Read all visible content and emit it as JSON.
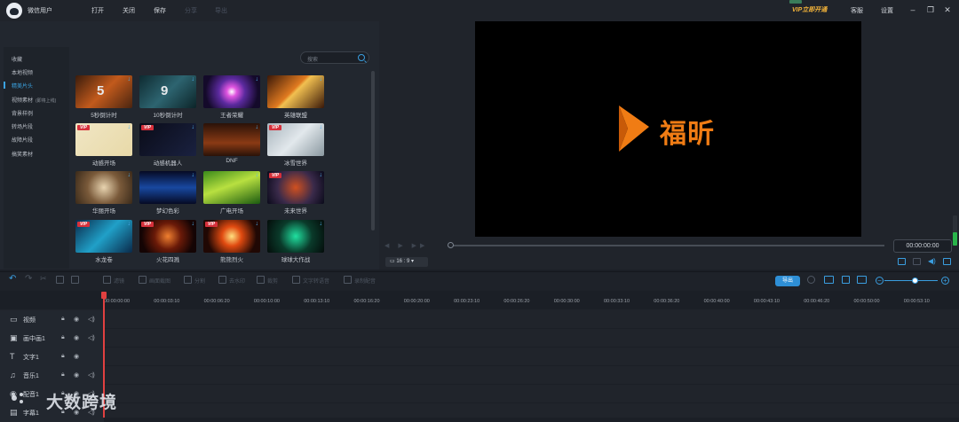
{
  "titlebar": {
    "username": "微信用户",
    "menus": [
      "打开",
      "关闭",
      "保存",
      "分享",
      "导出"
    ],
    "vip_label": "VIP立即开通",
    "service": "客服",
    "settings": "设置"
  },
  "sidebar": {
    "items": [
      {
        "label": "收藏"
      },
      {
        "label": "本地视频"
      },
      {
        "label": "精美片头"
      },
      {
        "label": "视频素材",
        "sub": "(即将上线)"
      },
      {
        "label": "背景样例"
      },
      {
        "label": "转场片段"
      },
      {
        "label": "故障片段"
      },
      {
        "label": "搞笑素材"
      }
    ],
    "active_index": 2
  },
  "search": {
    "placeholder": "搜索"
  },
  "templates": [
    {
      "label": "5秒倒计时",
      "vip": false,
      "badge": "5"
    },
    {
      "label": "10秒倒计时",
      "vip": false,
      "badge": "9"
    },
    {
      "label": "王者荣耀",
      "vip": false
    },
    {
      "label": "英雄联盟",
      "vip": false
    },
    {
      "label": "动感开场",
      "vip": true
    },
    {
      "label": "动感机器人",
      "vip": true
    },
    {
      "label": "DNF",
      "vip": false
    },
    {
      "label": "冰雪世界",
      "vip": true
    },
    {
      "label": "华丽开场",
      "vip": false
    },
    {
      "label": "梦幻色彩",
      "vip": false
    },
    {
      "label": "广电开场",
      "vip": false
    },
    {
      "label": "未来世界",
      "vip": true
    },
    {
      "label": "水龙卷",
      "vip": true
    },
    {
      "label": "火花四溅",
      "vip": true
    },
    {
      "label": "熊熊烈火",
      "vip": true
    },
    {
      "label": "球球大作战",
      "vip": false
    }
  ],
  "vip_tag": "VIP",
  "preview": {
    "logo_text": "福昕",
    "timecode": "00:00:00:00",
    "ratio": "16 : 9"
  },
  "toolbar": {
    "tools": [
      "滤镜",
      "画面截图",
      "分割",
      "去水印",
      "裁剪",
      "文字转语音",
      "录制配音"
    ],
    "export_label": "导出"
  },
  "ruler": {
    "ticks": [
      "00:00:00:00",
      "00:00:03:10",
      "00:00:06:20",
      "00:00:10:00",
      "00:00:13:10",
      "00:00:16:20",
      "00:00:20:00",
      "00:00:23:10",
      "00:00:26:20",
      "00:00:30:00",
      "00:00:33:10",
      "00:00:36:20",
      "00:00:40:00",
      "00:00:43:10",
      "00:00:46:20",
      "00:00:50:00",
      "00:00:53:10"
    ]
  },
  "tracks": [
    {
      "name": "视频"
    },
    {
      "name": "画中画1"
    },
    {
      "name": "文字1"
    },
    {
      "name": "音乐1"
    },
    {
      "name": "配音1"
    },
    {
      "name": "字幕1"
    }
  ],
  "watermark": "大数跨境",
  "colors": {
    "accent": "#2e8fd6",
    "vip": "#d6303b",
    "logo": "#f07c14",
    "playhead": "#e04040"
  }
}
